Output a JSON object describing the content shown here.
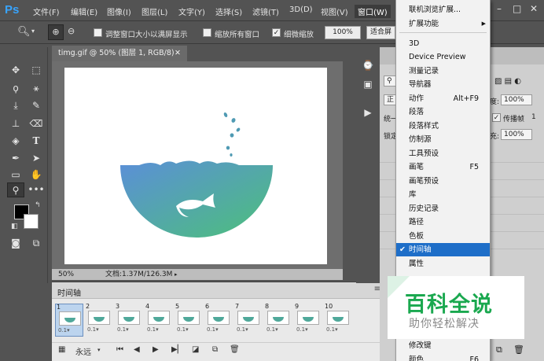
{
  "app": {
    "logo": "Ps"
  },
  "menubar": {
    "items": [
      "文件(F)",
      "编辑(E)",
      "图像(I)",
      "图层(L)",
      "文字(Y)",
      "选择(S)",
      "滤镜(T)",
      "3D(D)",
      "视图(V)",
      "窗口(W)"
    ],
    "window_controls": [
      "–",
      "□",
      "✕"
    ]
  },
  "options_bar": {
    "checkboxes": [
      {
        "label": "调整窗口大小以满屏显示",
        "checked": false
      },
      {
        "label": "缩放所有窗口",
        "checked": false
      },
      {
        "label": "细微缩放",
        "checked": true
      }
    ],
    "zoom_value": "100%",
    "fit_button": "适合屏"
  },
  "document": {
    "tab_title": "timg.gif @ 50% (图层 1, RGB/8)",
    "tab_close": "✕",
    "zoom": "50%",
    "doc_info": "文档:1.37M/126.3M",
    "art_colors": {
      "gradient_start": "#5b8fd8",
      "gradient_end": "#4cc07a",
      "drops": "#4f9ab3"
    }
  },
  "timeline": {
    "title": "时间轴",
    "frames": [
      "1",
      "2",
      "3",
      "4",
      "5",
      "6",
      "7",
      "8",
      "9",
      "10"
    ],
    "frame_delay": "0.1▾",
    "loop_value": "永远"
  },
  "layers_panel": {
    "normal_label": "正",
    "opacity_label": "度:",
    "opacity_value": "100%",
    "unify_label": "统一",
    "propagate_label": "传播帧",
    "propagate_value": "1",
    "lock_label": "锁定",
    "fill_label": "充:",
    "fill_value": "100%"
  },
  "window_menu": {
    "items": [
      {
        "label": "联机浏览扩展...",
        "shortcut": ""
      },
      {
        "label": "扩展功能",
        "shortcut": "",
        "submenu": true
      },
      {
        "label": "3D",
        "shortcut": ""
      },
      {
        "label": "Device Preview",
        "shortcut": ""
      },
      {
        "label": "测量记录",
        "shortcut": ""
      },
      {
        "label": "导航器",
        "shortcut": ""
      },
      {
        "label": "动作",
        "shortcut": "Alt+F9"
      },
      {
        "label": "段落",
        "shortcut": ""
      },
      {
        "label": "段落样式",
        "shortcut": ""
      },
      {
        "label": "仿制源",
        "shortcut": ""
      },
      {
        "label": "工具预设",
        "shortcut": ""
      },
      {
        "label": "画笔",
        "shortcut": "F5"
      },
      {
        "label": "画笔预设",
        "shortcut": ""
      },
      {
        "label": "库",
        "shortcut": ""
      },
      {
        "label": "历史记录",
        "shortcut": ""
      },
      {
        "label": "路径",
        "shortcut": ""
      },
      {
        "label": "色板",
        "shortcut": ""
      },
      {
        "label": "时间轴",
        "shortcut": "",
        "checked": true,
        "selected": true
      },
      {
        "label": "属性",
        "shortcut": ""
      },
      {
        "label": "修改键",
        "shortcut": ""
      },
      {
        "label": "颜色",
        "shortcut": "F6"
      }
    ]
  },
  "watermark": {
    "title": "百科全说",
    "subtitle": "助你轻松解决"
  }
}
